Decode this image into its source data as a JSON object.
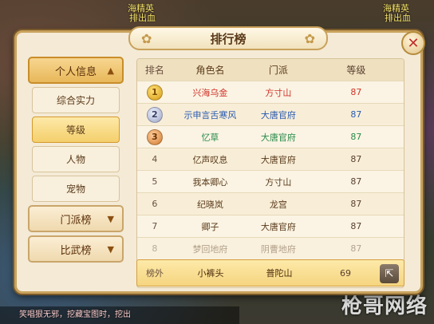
{
  "scene": {
    "top_text_1": "海精英",
    "top_text_2": "排出血",
    "top_text_3": "海精英",
    "top_text_4": "排出血",
    "chat_line": "笑唱狠无邪，挖藏宝图时，挖出",
    "watermark": "枪哥网络"
  },
  "panel": {
    "title": "排行榜",
    "close_label": "✕"
  },
  "sidebar": {
    "categories": [
      {
        "label": "个人信息",
        "expanded": true
      },
      {
        "label": "门派榜",
        "expanded": false
      },
      {
        "label": "比武榜",
        "expanded": false
      }
    ],
    "subitems": [
      {
        "label": "综合实力",
        "active": false
      },
      {
        "label": "等级",
        "active": true
      },
      {
        "label": "人物",
        "active": false
      },
      {
        "label": "宠物",
        "active": false
      }
    ]
  },
  "table": {
    "headers": [
      "排名",
      "角色名",
      "门派",
      "等级"
    ],
    "rows": [
      {
        "rank": "1",
        "name": "兴海乌金",
        "sect": "方寸山",
        "level": "87",
        "color": "red"
      },
      {
        "rank": "2",
        "name": "示申言舌寒风",
        "sect": "大唐官府",
        "level": "87",
        "color": "blue"
      },
      {
        "rank": "3",
        "name": "忆草",
        "sect": "大唐官府",
        "level": "87",
        "color": "green"
      },
      {
        "rank": "4",
        "name": "亿声叹息",
        "sect": "大唐官府",
        "level": "87",
        "color": "brown"
      },
      {
        "rank": "5",
        "name": "我本卿心",
        "sect": "方寸山",
        "level": "87",
        "color": "brown"
      },
      {
        "rank": "6",
        "name": "纪晓岚",
        "sect": "龙宫",
        "level": "87",
        "color": "brown"
      },
      {
        "rank": "7",
        "name": "卿子",
        "sect": "大唐官府",
        "level": "87",
        "color": "brown"
      },
      {
        "rank": "8",
        "name": "梦回地府",
        "sect": "阴曹地府",
        "level": "87",
        "color": "brown"
      }
    ],
    "self": {
      "rank": "榜外",
      "name": "小裤头",
      "sect": "普陀山",
      "level": "69"
    }
  }
}
